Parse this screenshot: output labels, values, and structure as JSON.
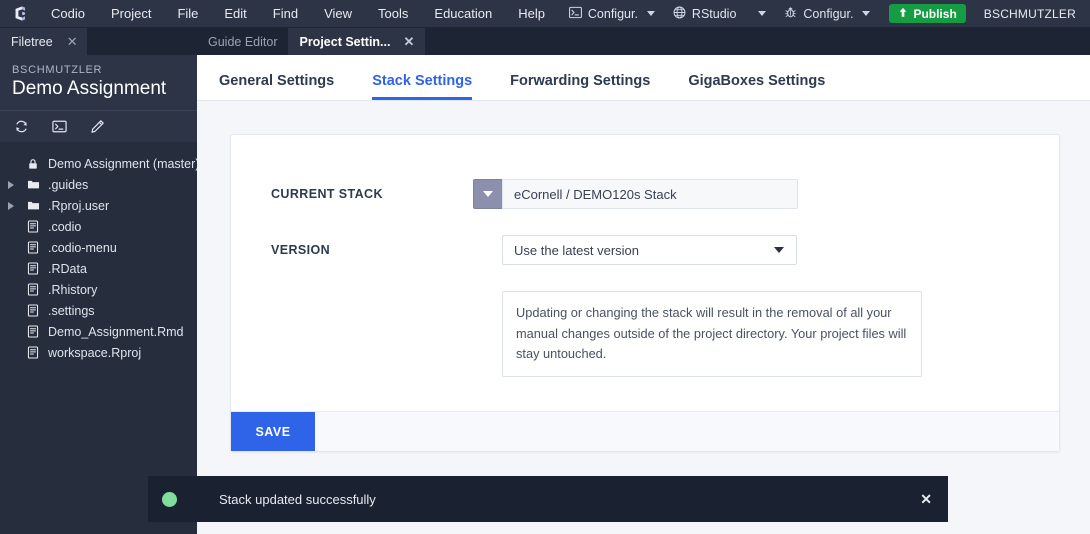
{
  "menubar": {
    "logo_icon": "codio-logo-icon",
    "items": [
      {
        "label": "Codio"
      },
      {
        "label": "Project"
      },
      {
        "label": "File"
      },
      {
        "label": "Edit"
      },
      {
        "label": "Find"
      },
      {
        "label": "View"
      },
      {
        "label": "Tools"
      },
      {
        "label": "Education"
      },
      {
        "label": "Help"
      }
    ],
    "tools": [
      {
        "label": "Configur.",
        "icon": "terminal-icon"
      },
      {
        "label": "RStudio",
        "icon": "globe-icon"
      },
      {
        "label": "Configur.",
        "icon": "bug-icon"
      }
    ],
    "publish_label": "Publish",
    "publish_color": "#169c43",
    "username": "BSCHMUTZLER"
  },
  "sidebar": {
    "panel_tab_label": "Filetree",
    "panel_close_icon": "close-icon",
    "project_owner": "BSCHMUTZLER",
    "project_name": "Demo Assignment",
    "toolbar_icons": [
      "refresh-icon",
      "terminal-icon",
      "pencil-icon"
    ],
    "tree": [
      {
        "label": "Demo Assignment (master)",
        "icon": "lock-icon",
        "expandable": false,
        "indent": 0
      },
      {
        "label": ".guides",
        "icon": "folder-icon",
        "expandable": true,
        "indent": 0
      },
      {
        "label": ".Rproj.user",
        "icon": "folder-icon",
        "expandable": true,
        "indent": 0
      },
      {
        "label": ".codio",
        "icon": "file-icon",
        "expandable": false,
        "indent": 1
      },
      {
        "label": ".codio-menu",
        "icon": "file-icon",
        "expandable": false,
        "indent": 1
      },
      {
        "label": ".RData",
        "icon": "file-icon",
        "expandable": false,
        "indent": 1
      },
      {
        "label": ".Rhistory",
        "icon": "file-icon",
        "expandable": false,
        "indent": 1
      },
      {
        "label": ".settings",
        "icon": "file-icon",
        "expandable": false,
        "indent": 1
      },
      {
        "label": "Demo_Assignment.Rmd",
        "icon": "file-icon",
        "expandable": false,
        "indent": 1
      },
      {
        "label": "workspace.Rproj",
        "icon": "file-icon",
        "expandable": false,
        "indent": 1
      }
    ]
  },
  "editor_tabs": [
    {
      "label": "Guide Editor",
      "active": false,
      "closable": false
    },
    {
      "label": "Project Settin...",
      "active": true,
      "closable": true
    }
  ],
  "settings_tabs": [
    {
      "label": "General Settings",
      "active": false
    },
    {
      "label": "Stack Settings",
      "active": true
    },
    {
      "label": "Forwarding Settings",
      "active": false
    },
    {
      "label": "GigaBoxes Settings",
      "active": false
    }
  ],
  "form": {
    "current_stack_label": "CURRENT STACK",
    "current_stack_value": "eCornell / DEMO120s Stack",
    "version_label": "VERSION",
    "version_value": "Use the latest version",
    "note": "Updating or changing the stack will result in the removal of all your manual changes outside of the project directory. Your project files will stay untouched.",
    "save_label": "SAVE",
    "accent_color": "#2f63e8"
  },
  "toast": {
    "message": "Stack updated successfully",
    "status_color": "#82dc9c",
    "close_icon": "close-icon"
  }
}
